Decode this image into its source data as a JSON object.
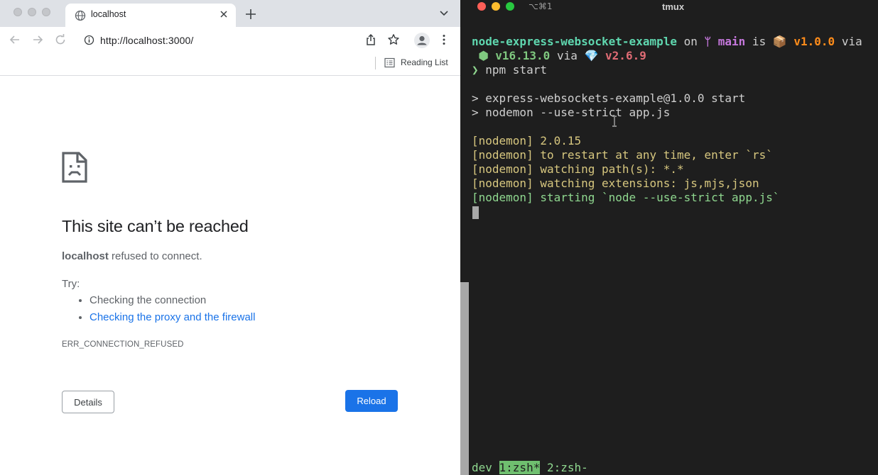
{
  "browser": {
    "tab": {
      "title": "localhost"
    },
    "address_bar": {
      "url": "http://localhost:3000/"
    },
    "bookmarks": {
      "reading_list": "Reading List"
    },
    "error_page": {
      "title": "This site can’t be reached",
      "host": "localhost",
      "message": " refused to connect.",
      "try_label": "Try:",
      "suggestions": [
        "Checking the connection",
        "Checking the proxy and the firewall"
      ],
      "error_code": "ERR_CONNECTION_REFUSED",
      "details_button": "Details",
      "reload_button": "Reload"
    }
  },
  "terminal": {
    "shortcut": "⌥⌘1",
    "title": "tmux",
    "prompt": {
      "project": "node-express-websocket-example",
      "on": " on ",
      "branch_icon": "ᛘ",
      "branch": " main",
      "is": " is ",
      "package_icon": "📦",
      "version": " v1.0.0",
      "via": " via",
      "node_icon": "⬢",
      "node_version": " v16.13.0",
      "via2": " via ",
      "ruby_icon": "💎",
      "ruby_version": " v2.6.9",
      "chevron": "❯",
      "command": " npm start"
    },
    "output": [
      "> express-websockets-example@1.0.0 start",
      "> nodemon --use-strict app.js"
    ],
    "nodemon": [
      "[nodemon] 2.0.15",
      "[nodemon] to restart at any time, enter `rs`",
      "[nodemon] watching path(s): *.*",
      "[nodemon] watching extensions: js,mjs,json"
    ],
    "nodemon_starting": "[nodemon] starting `node --use-strict app.js`",
    "status": {
      "session": "dev ",
      "active_window": "1:zsh*",
      "other_window": " 2:zsh-"
    }
  },
  "colors": {
    "reload_blue": "#1a73e8",
    "link_blue": "#1a73e8",
    "terminal_bg": "#1e1e1e",
    "mac_close": "#ff5f57",
    "mac_minimize": "#febc2e",
    "mac_zoom": "#28c840"
  },
  "icons": [
    "globe-icon",
    "close-icon",
    "plus-icon",
    "chevron-down-icon",
    "back-icon",
    "forward-icon",
    "reload-icon",
    "info-icon",
    "share-icon",
    "star-icon",
    "profile-icon",
    "kebab-menu-icon",
    "reading-list-icon",
    "sad-page-icon",
    "text-cursor-icon"
  ]
}
